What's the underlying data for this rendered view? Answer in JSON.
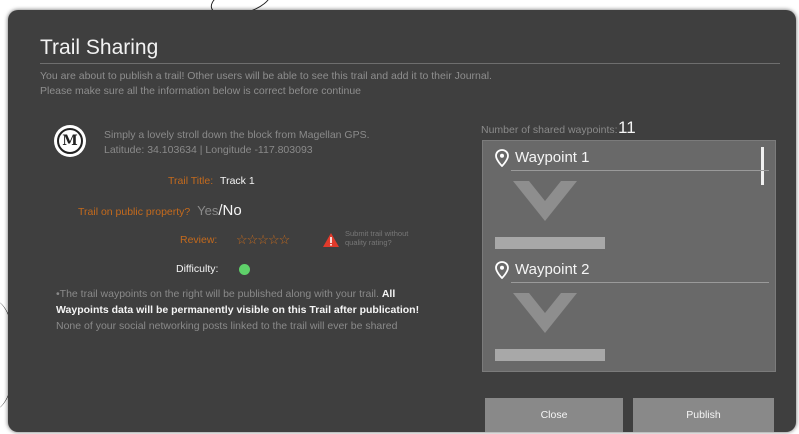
{
  "dialog": {
    "title": "Trail Sharing",
    "intro_line1": "You are about to publish a trail! Other users will be able to see this trail and add it to their Journal.",
    "intro_line2": "Please make sure all the information below is correct before continue"
  },
  "trail": {
    "desc_line1": "Simply a lovely stroll down the block from Magellan GPS.",
    "desc_line2": "Latitude: 34.103634 | Longitude -117.803093",
    "title_label": "Trail Title:",
    "title_value": "Track 1",
    "public_label": "Trail on public property?",
    "public_yes": "Yes",
    "public_no": "/No",
    "review_label": "Review:",
    "stars_text": "☆☆☆☆☆",
    "review_rating": 0,
    "submit_note": "Submit trail without quality rating?",
    "difficulty_label": "Difficulty:",
    "difficulty_color": "#5fd16a"
  },
  "notes": {
    "note1_grey": "•The trail waypoints on the right will be published along with your trail. ",
    "note1_bold": "All Waypoints data will be permanently visible on this Trail after publication!",
    "note2": "None of your social networking posts linked to the trail will ever be shared"
  },
  "waypoints": {
    "shared_label": "Number of shared waypoints:",
    "shared_count": "11",
    "items": [
      {
        "name": "Waypoint 1",
        "icon": "map-pin-icon"
      },
      {
        "name": "Waypoint 2",
        "icon": "map-pin-icon"
      }
    ]
  },
  "buttons": {
    "close": "Close",
    "publish": "Publish"
  },
  "colors": {
    "dialog_bg": "#3f3f3f",
    "accent_orange": "#c46a1d",
    "warning_red": "#e03a2b",
    "button_bg": "#898989"
  }
}
